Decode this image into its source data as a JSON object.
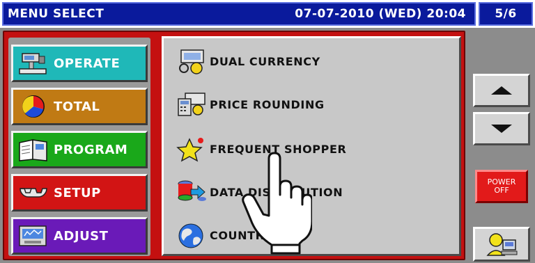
{
  "title_bar": {
    "title": "MENU SELECT",
    "datetime": "07-07-2010 (WED) 20:04",
    "page_indicator": "5/6"
  },
  "sidebar": {
    "items": [
      {
        "label": "OPERATE",
        "icon": "scale-icon",
        "color": "#1fb8b8"
      },
      {
        "label": "TOTAL",
        "icon": "pie-chart-icon",
        "color": "#c07a14"
      },
      {
        "label": "PROGRAM",
        "icon": "book-icon",
        "color": "#1aa81a"
      },
      {
        "label": "SETUP",
        "icon": "wrench-icon",
        "color": "#d21414"
      },
      {
        "label": "ADJUST",
        "icon": "gauge-icon",
        "color": "#6a1ab8"
      }
    ]
  },
  "content": {
    "items": [
      {
        "label": "DUAL CURRENCY",
        "icon": "currency-icon"
      },
      {
        "label": "PRICE ROUNDING",
        "icon": "calculator-icon"
      },
      {
        "label": "FREQUENT SHOPPER",
        "icon": "star-icon"
      },
      {
        "label": "DATA DISTRIBUTION",
        "icon": "database-icon"
      },
      {
        "label": "COUNTRY",
        "icon": "globe-icon"
      }
    ]
  },
  "side": {
    "up_icon": "triangle-up-icon",
    "down_icon": "triangle-down-icon",
    "power_line1": "POWER",
    "power_line2": "OFF",
    "user_icon": "user-icon"
  },
  "overlay": {
    "pointer_icon": "hand-pointer-icon"
  }
}
